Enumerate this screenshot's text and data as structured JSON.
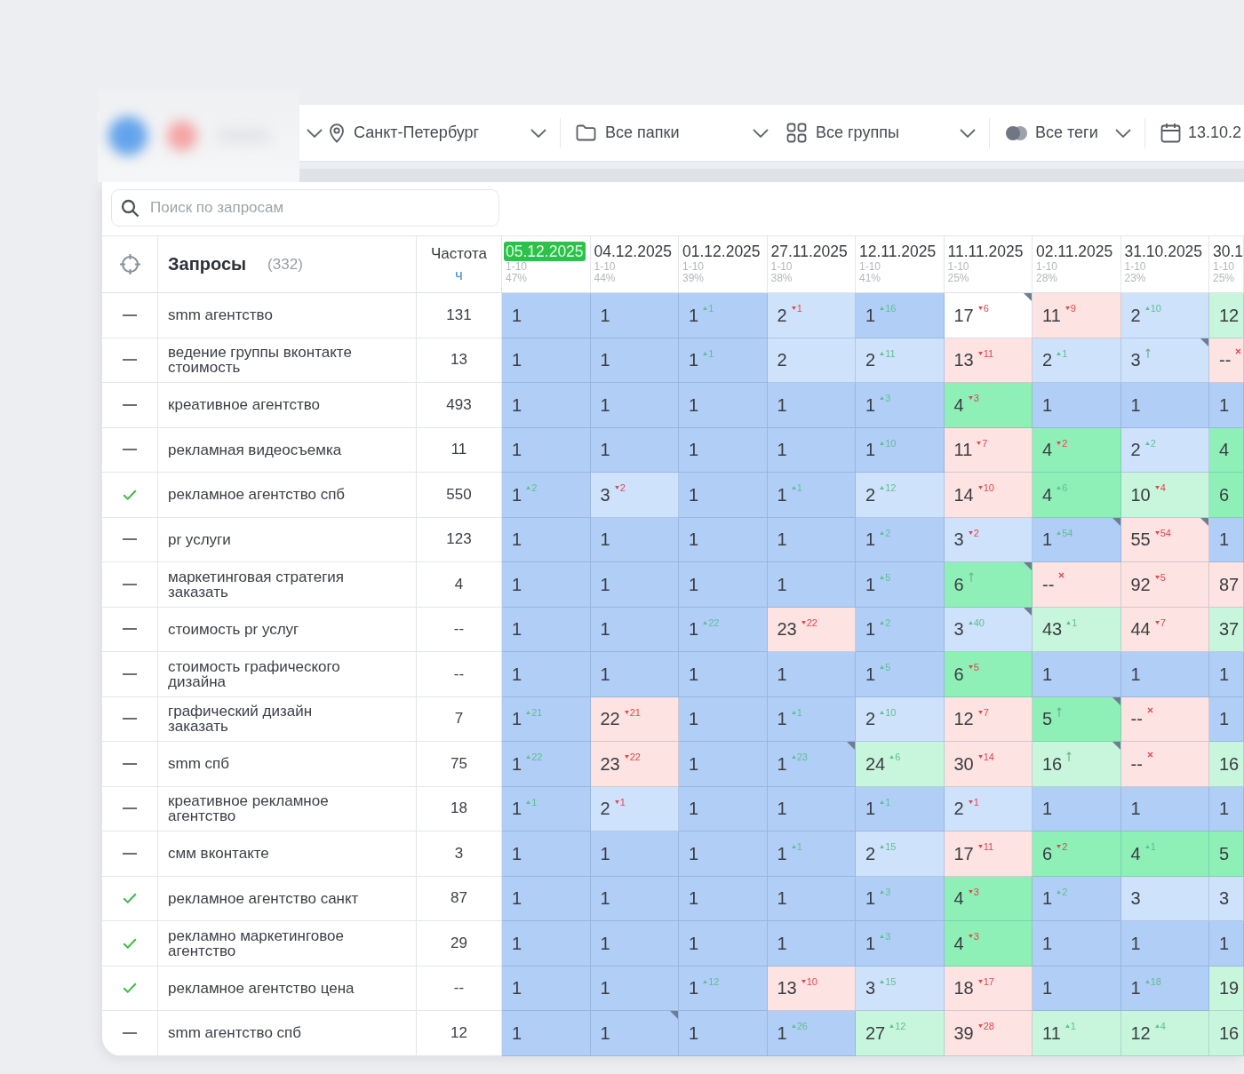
{
  "toolbar": {
    "filters": [
      {
        "kind": "location",
        "label": "Санкт-Петербург"
      },
      {
        "kind": "folder",
        "label": "Все папки"
      },
      {
        "kind": "groups",
        "label": "Все группы"
      },
      {
        "kind": "tags",
        "label": "Все теги"
      },
      {
        "kind": "date",
        "label": "13.10.2"
      }
    ]
  },
  "search": {
    "placeholder": "Поиск по запросам"
  },
  "table": {
    "title": "Запросы",
    "count": "(332)",
    "frequency": {
      "label": "Частота",
      "unit": "ч"
    },
    "dates": [
      {
        "date": "05.12.2025",
        "range": "1-10",
        "share": "47%",
        "selected": true
      },
      {
        "date": "04.12.2025",
        "range": "1-10",
        "share": "44%",
        "selected": false
      },
      {
        "date": "01.12.2025",
        "range": "1-10",
        "share": "39%",
        "selected": false
      },
      {
        "date": "27.11.2025",
        "range": "1-10",
        "share": "38%",
        "selected": false
      },
      {
        "date": "12.11.2025",
        "range": "1-10",
        "share": "41%",
        "selected": false
      },
      {
        "date": "11.11.2025",
        "range": "1-10",
        "share": "25%",
        "selected": false
      },
      {
        "date": "02.11.2025",
        "range": "1-10",
        "share": "28%",
        "selected": false
      },
      {
        "date": "31.10.2025",
        "range": "1-10",
        "share": "23%",
        "selected": false
      },
      {
        "date": "30.1",
        "range": "1-10",
        "share": "25%",
        "selected": false
      }
    ],
    "rows": [
      {
        "checked": false,
        "query": "smm агентство",
        "frequency": "131",
        "cells": [
          {
            "value": "1",
            "kind": "same",
            "color": "#b1cef7",
            "note": false
          },
          {
            "value": "1",
            "kind": "same",
            "color": "#b1cef7",
            "note": false
          },
          {
            "value": "1",
            "kind": "up",
            "delta": "1",
            "color": "#b1cef7",
            "note": false
          },
          {
            "value": "2",
            "kind": "down",
            "delta": "1",
            "color": "#cfe2fb",
            "note": false
          },
          {
            "value": "1",
            "kind": "up",
            "delta": "16",
            "color": "#b1cef7",
            "note": false
          },
          {
            "value": "17",
            "kind": "down",
            "delta": "6",
            "color": "#ffffff",
            "note": true
          },
          {
            "value": "11",
            "kind": "down",
            "delta": "9",
            "color": "#fde3e1",
            "note": false
          },
          {
            "value": "2",
            "kind": "up",
            "delta": "10",
            "color": "#cfe2fb",
            "note": false
          },
          {
            "value": "12",
            "kind": "same",
            "color": "#c8f6dc",
            "note": false
          }
        ]
      },
      {
        "checked": false,
        "query": "ведение группы вконтакте стоимость",
        "frequency": "13",
        "cells": [
          {
            "value": "1",
            "kind": "same",
            "color": "#b1cef7",
            "note": false
          },
          {
            "value": "1",
            "kind": "same",
            "color": "#b1cef7",
            "note": false
          },
          {
            "value": "1",
            "kind": "up",
            "delta": "1",
            "color": "#b1cef7",
            "note": false
          },
          {
            "value": "2",
            "kind": "same",
            "color": "#cfe2fb",
            "note": false
          },
          {
            "value": "2",
            "kind": "up",
            "delta": "11",
            "color": "#cfe2fb",
            "note": false
          },
          {
            "value": "13",
            "kind": "down",
            "delta": "11",
            "color": "#fde3e1",
            "note": false
          },
          {
            "value": "2",
            "kind": "up",
            "delta": "1",
            "color": "#cfe2fb",
            "note": false
          },
          {
            "value": "3",
            "kind": "new",
            "color": "#cfe2fb",
            "note": true
          },
          {
            "value": "--",
            "kind": "gone",
            "color": "#fde3e1",
            "note": false
          }
        ]
      },
      {
        "checked": false,
        "query": "креативное агентство",
        "frequency": "493",
        "cells": [
          {
            "value": "1",
            "kind": "same",
            "color": "#b1cef7",
            "note": false
          },
          {
            "value": "1",
            "kind": "same",
            "color": "#b1cef7",
            "note": false
          },
          {
            "value": "1",
            "kind": "same",
            "color": "#b1cef7",
            "note": false
          },
          {
            "value": "1",
            "kind": "same",
            "color": "#b1cef7",
            "note": false
          },
          {
            "value": "1",
            "kind": "up",
            "delta": "3",
            "color": "#b1cef7",
            "note": false
          },
          {
            "value": "4",
            "kind": "down",
            "delta": "3",
            "color": "#8ef0b6",
            "note": false
          },
          {
            "value": "1",
            "kind": "same",
            "color": "#b1cef7",
            "note": false
          },
          {
            "value": "1",
            "kind": "same",
            "color": "#b1cef7",
            "note": false
          },
          {
            "value": "1",
            "kind": "same",
            "color": "#b1cef7",
            "note": false
          }
        ]
      },
      {
        "checked": false,
        "query": "рекламная видеосъемка",
        "frequency": "11",
        "cells": [
          {
            "value": "1",
            "kind": "same",
            "color": "#b1cef7",
            "note": false
          },
          {
            "value": "1",
            "kind": "same",
            "color": "#b1cef7",
            "note": false
          },
          {
            "value": "1",
            "kind": "same",
            "color": "#b1cef7",
            "note": false
          },
          {
            "value": "1",
            "kind": "same",
            "color": "#b1cef7",
            "note": false
          },
          {
            "value": "1",
            "kind": "up",
            "delta": "10",
            "color": "#b1cef7",
            "note": false
          },
          {
            "value": "11",
            "kind": "down",
            "delta": "7",
            "color": "#fde3e1",
            "note": false
          },
          {
            "value": "4",
            "kind": "down",
            "delta": "2",
            "color": "#8ef0b6",
            "note": false
          },
          {
            "value": "2",
            "kind": "up",
            "delta": "2",
            "color": "#cfe2fb",
            "note": false
          },
          {
            "value": "4",
            "kind": "same",
            "color": "#8ef0b6",
            "note": false
          }
        ]
      },
      {
        "checked": true,
        "query": "рекламное агентство спб",
        "frequency": "550",
        "cells": [
          {
            "value": "1",
            "kind": "up",
            "delta": "2",
            "color": "#b1cef7",
            "note": false
          },
          {
            "value": "3",
            "kind": "down",
            "delta": "2",
            "color": "#cfe2fb",
            "note": false
          },
          {
            "value": "1",
            "kind": "same",
            "color": "#b1cef7",
            "note": false
          },
          {
            "value": "1",
            "kind": "up",
            "delta": "1",
            "color": "#b1cef7",
            "note": false
          },
          {
            "value": "2",
            "kind": "up",
            "delta": "12",
            "color": "#cfe2fb",
            "note": false
          },
          {
            "value": "14",
            "kind": "down",
            "delta": "10",
            "color": "#fde3e1",
            "note": false
          },
          {
            "value": "4",
            "kind": "up",
            "delta": "6",
            "color": "#8ef0b6",
            "note": false
          },
          {
            "value": "10",
            "kind": "down",
            "delta": "4",
            "color": "#c8f6dc",
            "note": false
          },
          {
            "value": "6",
            "kind": "same",
            "color": "#8ef0b6",
            "note": false
          }
        ]
      },
      {
        "checked": false,
        "query": "pr услуги",
        "frequency": "123",
        "cells": [
          {
            "value": "1",
            "kind": "same",
            "color": "#b1cef7",
            "note": false
          },
          {
            "value": "1",
            "kind": "same",
            "color": "#b1cef7",
            "note": false
          },
          {
            "value": "1",
            "kind": "same",
            "color": "#b1cef7",
            "note": false
          },
          {
            "value": "1",
            "kind": "same",
            "color": "#b1cef7",
            "note": false
          },
          {
            "value": "1",
            "kind": "up",
            "delta": "2",
            "color": "#b1cef7",
            "note": false
          },
          {
            "value": "3",
            "kind": "down",
            "delta": "2",
            "color": "#cfe2fb",
            "note": false
          },
          {
            "value": "1",
            "kind": "up",
            "delta": "54",
            "color": "#b1cef7",
            "note": true
          },
          {
            "value": "55",
            "kind": "down",
            "delta": "54",
            "color": "#fde3e1",
            "note": true
          },
          {
            "value": "1",
            "kind": "same",
            "color": "#b1cef7",
            "note": false
          }
        ]
      },
      {
        "checked": false,
        "query": "маркетинговая стратегия заказать",
        "frequency": "4",
        "cells": [
          {
            "value": "1",
            "kind": "same",
            "color": "#b1cef7",
            "note": false
          },
          {
            "value": "1",
            "kind": "same",
            "color": "#b1cef7",
            "note": false
          },
          {
            "value": "1",
            "kind": "same",
            "color": "#b1cef7",
            "note": false
          },
          {
            "value": "1",
            "kind": "same",
            "color": "#b1cef7",
            "note": false
          },
          {
            "value": "1",
            "kind": "up",
            "delta": "5",
            "color": "#b1cef7",
            "note": false
          },
          {
            "value": "6",
            "kind": "new",
            "color": "#8ef0b6",
            "note": true
          },
          {
            "value": "--",
            "kind": "gone",
            "color": "#fde3e1",
            "note": false
          },
          {
            "value": "92",
            "kind": "down",
            "delta": "5",
            "color": "#fde3e1",
            "note": false
          },
          {
            "value": "87",
            "kind": "same",
            "color": "#fde3e1",
            "note": false
          }
        ]
      },
      {
        "checked": false,
        "query": "стоимость pr услуг",
        "frequency": "--",
        "cells": [
          {
            "value": "1",
            "kind": "same",
            "color": "#b1cef7",
            "note": false
          },
          {
            "value": "1",
            "kind": "same",
            "color": "#b1cef7",
            "note": false
          },
          {
            "value": "1",
            "kind": "up",
            "delta": "22",
            "color": "#b1cef7",
            "note": false
          },
          {
            "value": "23",
            "kind": "down",
            "delta": "22",
            "color": "#fde3e1",
            "note": false
          },
          {
            "value": "1",
            "kind": "up",
            "delta": "2",
            "color": "#b1cef7",
            "note": false
          },
          {
            "value": "3",
            "kind": "up",
            "delta": "40",
            "color": "#cfe2fb",
            "note": true
          },
          {
            "value": "43",
            "kind": "up",
            "delta": "1",
            "color": "#c8f6dc",
            "note": false
          },
          {
            "value": "44",
            "kind": "down",
            "delta": "7",
            "color": "#fde3e1",
            "note": false
          },
          {
            "value": "37",
            "kind": "same",
            "color": "#c8f6dc",
            "note": false
          }
        ]
      },
      {
        "checked": false,
        "query": "стоимость графического дизайна",
        "frequency": "--",
        "cells": [
          {
            "value": "1",
            "kind": "same",
            "color": "#b1cef7",
            "note": false
          },
          {
            "value": "1",
            "kind": "same",
            "color": "#b1cef7",
            "note": false
          },
          {
            "value": "1",
            "kind": "same",
            "color": "#b1cef7",
            "note": false
          },
          {
            "value": "1",
            "kind": "same",
            "color": "#b1cef7",
            "note": false
          },
          {
            "value": "1",
            "kind": "up",
            "delta": "5",
            "color": "#b1cef7",
            "note": false
          },
          {
            "value": "6",
            "kind": "down",
            "delta": "5",
            "color": "#8ef0b6",
            "note": false
          },
          {
            "value": "1",
            "kind": "same",
            "color": "#b1cef7",
            "note": false
          },
          {
            "value": "1",
            "kind": "same",
            "color": "#b1cef7",
            "note": false
          },
          {
            "value": "1",
            "kind": "same",
            "color": "#b1cef7",
            "note": false
          }
        ]
      },
      {
        "checked": false,
        "query": "графический дизайн заказать",
        "frequency": "7",
        "cells": [
          {
            "value": "1",
            "kind": "up",
            "delta": "21",
            "color": "#b1cef7",
            "note": false
          },
          {
            "value": "22",
            "kind": "down",
            "delta": "21",
            "color": "#fde3e1",
            "note": false
          },
          {
            "value": "1",
            "kind": "same",
            "color": "#b1cef7",
            "note": false
          },
          {
            "value": "1",
            "kind": "up",
            "delta": "1",
            "color": "#b1cef7",
            "note": false
          },
          {
            "value": "2",
            "kind": "up",
            "delta": "10",
            "color": "#cfe2fb",
            "note": false
          },
          {
            "value": "12",
            "kind": "down",
            "delta": "7",
            "color": "#fde3e1",
            "note": false
          },
          {
            "value": "5",
            "kind": "new",
            "color": "#8ef0b6",
            "note": true
          },
          {
            "value": "--",
            "kind": "gone",
            "color": "#fde3e1",
            "note": false
          },
          {
            "value": "1",
            "kind": "same",
            "color": "#b1cef7",
            "note": false
          }
        ]
      },
      {
        "checked": false,
        "query": "smm спб",
        "frequency": "75",
        "cells": [
          {
            "value": "1",
            "kind": "up",
            "delta": "22",
            "color": "#b1cef7",
            "note": false
          },
          {
            "value": "23",
            "kind": "down",
            "delta": "22",
            "color": "#fde3e1",
            "note": false
          },
          {
            "value": "1",
            "kind": "same",
            "color": "#b1cef7",
            "note": false
          },
          {
            "value": "1",
            "kind": "up",
            "delta": "23",
            "color": "#b1cef7",
            "note": true
          },
          {
            "value": "24",
            "kind": "up",
            "delta": "6",
            "color": "#c8f6dc",
            "note": false
          },
          {
            "value": "30",
            "kind": "down",
            "delta": "14",
            "color": "#fde3e1",
            "note": false
          },
          {
            "value": "16",
            "kind": "new",
            "color": "#c8f6dc",
            "note": true
          },
          {
            "value": "--",
            "kind": "gone",
            "color": "#fde3e1",
            "note": false
          },
          {
            "value": "16",
            "kind": "same",
            "color": "#c8f6dc",
            "note": false
          }
        ]
      },
      {
        "checked": false,
        "query": "креативное рекламное агентство",
        "frequency": "18",
        "cells": [
          {
            "value": "1",
            "kind": "up",
            "delta": "1",
            "color": "#b1cef7",
            "note": false
          },
          {
            "value": "2",
            "kind": "down",
            "delta": "1",
            "color": "#cfe2fb",
            "note": false
          },
          {
            "value": "1",
            "kind": "same",
            "color": "#b1cef7",
            "note": false
          },
          {
            "value": "1",
            "kind": "same",
            "color": "#b1cef7",
            "note": false
          },
          {
            "value": "1",
            "kind": "up",
            "delta": "1",
            "color": "#b1cef7",
            "note": false
          },
          {
            "value": "2",
            "kind": "down",
            "delta": "1",
            "color": "#cfe2fb",
            "note": false
          },
          {
            "value": "1",
            "kind": "same",
            "color": "#b1cef7",
            "note": false
          },
          {
            "value": "1",
            "kind": "same",
            "color": "#b1cef7",
            "note": false
          },
          {
            "value": "1",
            "kind": "same",
            "color": "#b1cef7",
            "note": false
          }
        ]
      },
      {
        "checked": false,
        "query": "смм вконтакте",
        "frequency": "3",
        "cells": [
          {
            "value": "1",
            "kind": "same",
            "color": "#b1cef7",
            "note": false
          },
          {
            "value": "1",
            "kind": "same",
            "color": "#b1cef7",
            "note": false
          },
          {
            "value": "1",
            "kind": "same",
            "color": "#b1cef7",
            "note": false
          },
          {
            "value": "1",
            "kind": "up",
            "delta": "1",
            "color": "#b1cef7",
            "note": false
          },
          {
            "value": "2",
            "kind": "up",
            "delta": "15",
            "color": "#cfe2fb",
            "note": false
          },
          {
            "value": "17",
            "kind": "down",
            "delta": "11",
            "color": "#fde3e1",
            "note": false
          },
          {
            "value": "6",
            "kind": "down",
            "delta": "2",
            "color": "#8ef0b6",
            "note": false
          },
          {
            "value": "4",
            "kind": "up",
            "delta": "1",
            "color": "#8ef0b6",
            "note": false
          },
          {
            "value": "5",
            "kind": "same",
            "color": "#8ef0b6",
            "note": false
          }
        ]
      },
      {
        "checked": true,
        "query": "рекламное агентство санкт",
        "frequency": "87",
        "cells": [
          {
            "value": "1",
            "kind": "same",
            "color": "#b1cef7",
            "note": false
          },
          {
            "value": "1",
            "kind": "same",
            "color": "#b1cef7",
            "note": false
          },
          {
            "value": "1",
            "kind": "same",
            "color": "#b1cef7",
            "note": false
          },
          {
            "value": "1",
            "kind": "same",
            "color": "#b1cef7",
            "note": false
          },
          {
            "value": "1",
            "kind": "up",
            "delta": "3",
            "color": "#b1cef7",
            "note": false
          },
          {
            "value": "4",
            "kind": "down",
            "delta": "3",
            "color": "#8ef0b6",
            "note": false
          },
          {
            "value": "1",
            "kind": "up",
            "delta": "2",
            "color": "#b1cef7",
            "note": false
          },
          {
            "value": "3",
            "kind": "same",
            "color": "#cfe2fb",
            "note": false
          },
          {
            "value": "3",
            "kind": "same",
            "color": "#cfe2fb",
            "note": false
          }
        ]
      },
      {
        "checked": true,
        "query": "рекламно маркетинговое агентство",
        "frequency": "29",
        "cells": [
          {
            "value": "1",
            "kind": "same",
            "color": "#b1cef7",
            "note": false
          },
          {
            "value": "1",
            "kind": "same",
            "color": "#b1cef7",
            "note": false
          },
          {
            "value": "1",
            "kind": "same",
            "color": "#b1cef7",
            "note": false
          },
          {
            "value": "1",
            "kind": "same",
            "color": "#b1cef7",
            "note": false
          },
          {
            "value": "1",
            "kind": "up",
            "delta": "3",
            "color": "#b1cef7",
            "note": false
          },
          {
            "value": "4",
            "kind": "down",
            "delta": "3",
            "color": "#8ef0b6",
            "note": false
          },
          {
            "value": "1",
            "kind": "same",
            "color": "#b1cef7",
            "note": false
          },
          {
            "value": "1",
            "kind": "same",
            "color": "#b1cef7",
            "note": false
          },
          {
            "value": "1",
            "kind": "same",
            "color": "#b1cef7",
            "note": false
          }
        ]
      },
      {
        "checked": true,
        "query": "рекламное агентство цена",
        "frequency": "--",
        "cells": [
          {
            "value": "1",
            "kind": "same",
            "color": "#b1cef7",
            "note": false
          },
          {
            "value": "1",
            "kind": "same",
            "color": "#b1cef7",
            "note": false
          },
          {
            "value": "1",
            "kind": "up",
            "delta": "12",
            "color": "#b1cef7",
            "note": false
          },
          {
            "value": "13",
            "kind": "down",
            "delta": "10",
            "color": "#fde3e1",
            "note": false
          },
          {
            "value": "3",
            "kind": "up",
            "delta": "15",
            "color": "#cfe2fb",
            "note": false
          },
          {
            "value": "18",
            "kind": "down",
            "delta": "17",
            "color": "#fde3e1",
            "note": false
          },
          {
            "value": "1",
            "kind": "same",
            "color": "#b1cef7",
            "note": false
          },
          {
            "value": "1",
            "kind": "up",
            "delta": "18",
            "color": "#b1cef7",
            "note": false
          },
          {
            "value": "19",
            "kind": "same",
            "color": "#c8f6dc",
            "note": false
          }
        ]
      },
      {
        "checked": false,
        "query": "smm агентство спб",
        "frequency": "12",
        "cells": [
          {
            "value": "1",
            "kind": "same",
            "color": "#b1cef7",
            "note": false
          },
          {
            "value": "1",
            "kind": "same",
            "color": "#b1cef7",
            "note": true
          },
          {
            "value": "1",
            "kind": "same",
            "color": "#b1cef7",
            "note": false
          },
          {
            "value": "1",
            "kind": "up",
            "delta": "26",
            "color": "#b1cef7",
            "note": false
          },
          {
            "value": "27",
            "kind": "up",
            "delta": "12",
            "color": "#c8f6dc",
            "note": false
          },
          {
            "value": "39",
            "kind": "down",
            "delta": "28",
            "color": "#fde3e1",
            "note": false
          },
          {
            "value": "11",
            "kind": "up",
            "delta": "1",
            "color": "#c8f6dc",
            "note": false
          },
          {
            "value": "12",
            "kind": "up",
            "delta": "4",
            "color": "#c8f6dc",
            "note": false
          },
          {
            "value": "16",
            "kind": "same",
            "color": "#c8f6dc",
            "note": false
          }
        ]
      }
    ]
  }
}
